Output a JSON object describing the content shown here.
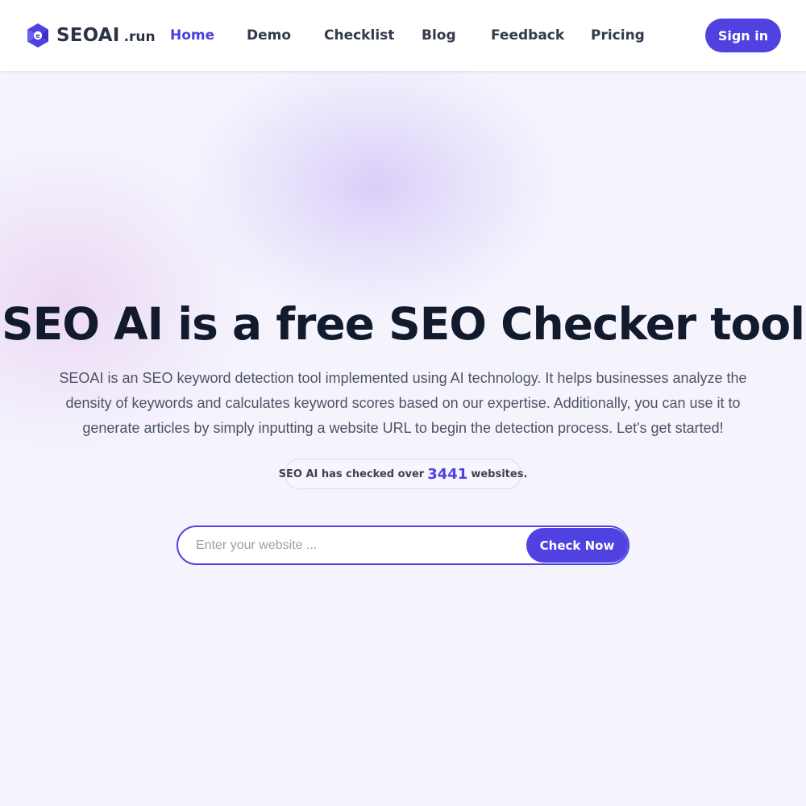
{
  "brand": {
    "name": "SEOAI",
    "suffix": ".run",
    "accent_color": "#4f42e0",
    "icon": "seoai-logo-icon"
  },
  "nav": {
    "items": [
      {
        "label": "Home",
        "active": true
      },
      {
        "label": "Demo",
        "active": false
      },
      {
        "label": "Checklist",
        "active": false
      },
      {
        "label": "Blog",
        "active": false
      },
      {
        "label": "Feedback",
        "active": false
      },
      {
        "label": "Pricing",
        "active": false
      }
    ],
    "signin_label": "Sign in"
  },
  "hero": {
    "title": "SEO AI is a free SEO Checker tool",
    "description": "SEOAI is an SEO keyword detection tool implemented using AI technology. It helps businesses analyze the density of keywords and calculates keyword scores based on our expertise. Additionally, you can use it to generate articles by simply inputting a website URL to begin the detection process. Let's get started!",
    "counter": {
      "prefix": "SEO AI has checked over",
      "count": "3441",
      "suffix": "websites."
    }
  },
  "search": {
    "placeholder": "Enter your website ...",
    "value": "",
    "button_label": "Check Now"
  }
}
